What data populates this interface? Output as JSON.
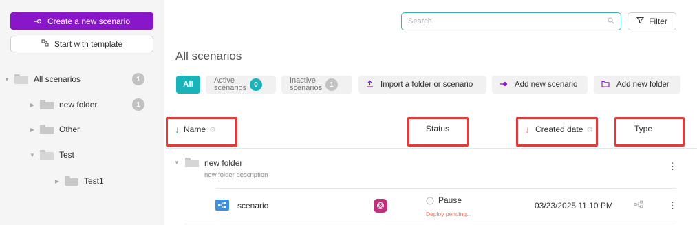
{
  "sidebar": {
    "create_button": "Create a new scenario",
    "template_button": "Start with template",
    "tree": [
      {
        "label": "All scenarios",
        "count": "1"
      },
      {
        "label": "new folder",
        "count": "1"
      },
      {
        "label": "Other"
      },
      {
        "label": "Test"
      },
      {
        "label": "Test1"
      }
    ]
  },
  "toolbar": {
    "search_placeholder": "Search",
    "filter_label": "Filter"
  },
  "page_title": "All scenarios",
  "chips": {
    "all": "All",
    "active": {
      "line1": "Active",
      "line2": "scenarios",
      "count": "0"
    },
    "inactive": {
      "line1": "Inactive",
      "line2": "scenarios",
      "count": "1"
    },
    "import": "Import a folder or scenario",
    "add_scenario": "Add new scenario",
    "add_folder": "Add new folder"
  },
  "table": {
    "columns": {
      "name": "Name",
      "status": "Status",
      "created": "Created date",
      "type": "Type"
    },
    "folder_row": {
      "name": "new folder",
      "description": "new folder description"
    },
    "scenario_row": {
      "name": "scenario",
      "status": "Pause",
      "status_note": "Deploy pending...",
      "created": "03/23/2025 11:10 PM"
    }
  },
  "colors": {
    "accent": "#8a16c9",
    "teal": "#1ab3ba",
    "highlight": "#e03c3c"
  }
}
